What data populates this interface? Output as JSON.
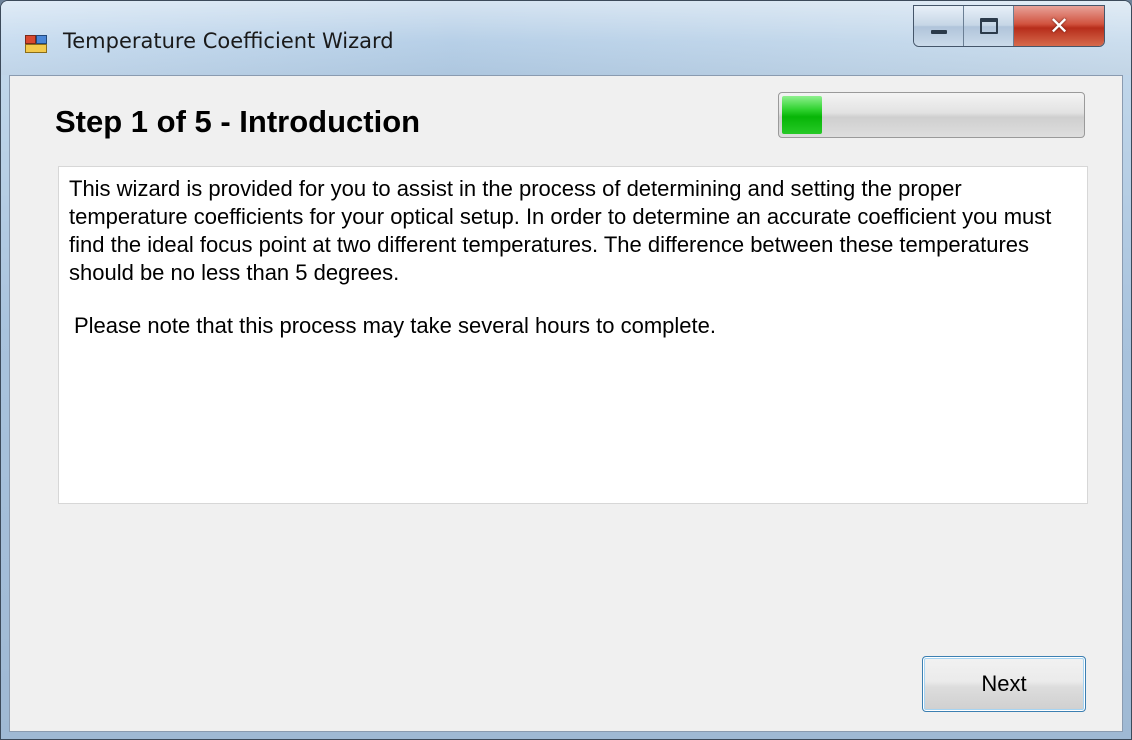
{
  "window": {
    "title": "Temperature Coefficient Wizard",
    "icon": "application-icon",
    "controls": {
      "minimize_icon": "minimize-icon",
      "maximize_icon": "maximize-icon",
      "close_icon": "close-icon",
      "close_glyph": "✕"
    }
  },
  "wizard": {
    "step_title": "Step 1 of 5 - Introduction",
    "progress_fraction": 0.15,
    "progress_color": "#07b507",
    "description": "This wizard is provided for you to assist in the process of determining and setting the proper temperature coefficients for your optical setup. In order to determine an accurate coefficient you must find the ideal focus point at two different temperatures. The difference between these temperatures should be no less than 5 degrees.",
    "note": "Please note that this process may take several hours to complete."
  },
  "buttons": {
    "next_label": "Next"
  }
}
